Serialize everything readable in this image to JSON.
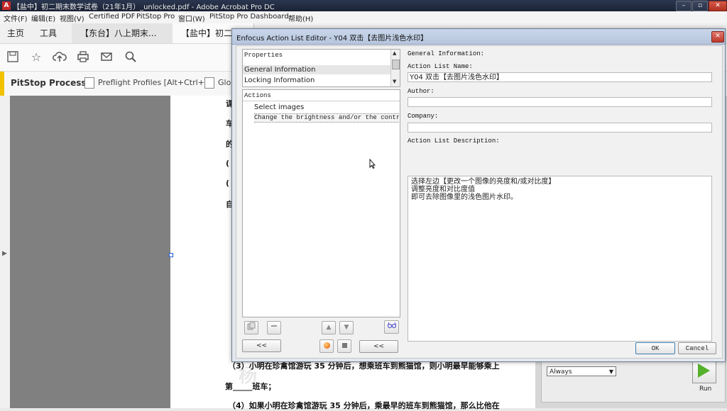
{
  "window": {
    "title": "【盐中】初二期末数学试卷（21年1月）_unlocked.pdf - Adobe Acrobat Pro DC",
    "app_icon": "acrobat-icon"
  },
  "menu": [
    "文件(F)",
    "编辑(E)",
    "视图(V)",
    "Certified PDF",
    "PitStop Pro",
    "窗口(W)",
    "PitStop Pro Dashboard",
    "帮助(H)"
  ],
  "tabs": {
    "home": "主页",
    "tools": "工具",
    "doc1": "【东台】八上期末...",
    "doc2": "【盐中】初二期..."
  },
  "pitstop": {
    "title": "PitStop Process",
    "preflight": "Preflight Profiles [Alt+Ctrl+P]",
    "global": "Glol"
  },
  "page_text": {
    "char1": "课",
    "char2": "车",
    "char3": "的",
    "char4": "(",
    "char5": "(",
    "char6": "自",
    "line_3": "（3）小明在珍禽馆游玩 35 分钟后，想乘班车到熊猫馆，则小明最早能够乘上",
    "line_blank": "第_____班车；",
    "line_4": "（4）如果小明在珍禽馆游玩 35 分钟后，乘最早的班车到熊猫馆，那么比他在",
    "watermark": "杨"
  },
  "run_panel": {
    "select_value": "Always",
    "run_label": "Run"
  },
  "dialog": {
    "title": "Enfocus Action List Editor - Y04 双击【去图片浅色水印】",
    "properties_header": "Properties",
    "properties_items": [
      "General Information",
      "Locking Information"
    ],
    "actions_header": "Actions",
    "actions": [
      "Select images",
      "Change the brightness and/or the contr…"
    ],
    "form": {
      "section": "General Information:",
      "name_label": "Action List Name:",
      "name_value": "Y04 双击【去图片浅色水印】",
      "author_label": "Author:",
      "author_value": "",
      "company_label": "Company:",
      "company_value": "",
      "desc_label": "Action List Description:",
      "desc_lines": [
        "选择左边【更改一个图像的亮度和/或对比度】",
        "调整亮度和对比度值",
        "即可去除图像里的浅色图片水印。"
      ]
    },
    "buttons": {
      "collapse_left": "<<",
      "collapse_right": "<<",
      "ok": "OK",
      "cancel": "Cancel"
    }
  }
}
